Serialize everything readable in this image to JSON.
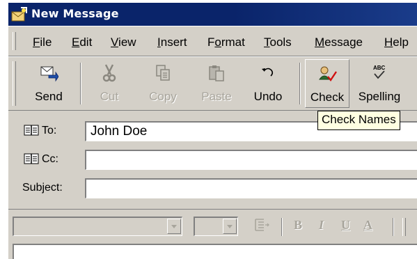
{
  "window": {
    "title": "New Message"
  },
  "menu": [
    {
      "pre": "",
      "u": "F",
      "post": "ile"
    },
    {
      "pre": "",
      "u": "E",
      "post": "dit"
    },
    {
      "pre": "",
      "u": "V",
      "post": "iew"
    },
    {
      "pre": "",
      "u": "I",
      "post": "nsert"
    },
    {
      "pre": "F",
      "u": "o",
      "post": "rmat"
    },
    {
      "pre": "",
      "u": "T",
      "post": "ools"
    },
    {
      "pre": "",
      "u": "M",
      "post": "essage"
    },
    {
      "pre": "",
      "u": "H",
      "post": "elp"
    }
  ],
  "toolbar": {
    "send": {
      "label": "Send",
      "icon": "send-icon",
      "enabled": true
    },
    "cut": {
      "label": "Cut",
      "icon": "scissors-icon",
      "enabled": false
    },
    "copy": {
      "label": "Copy",
      "icon": "copy-icon",
      "enabled": false
    },
    "paste": {
      "label": "Paste",
      "icon": "paste-icon",
      "enabled": false
    },
    "undo": {
      "label": "Undo",
      "icon": "undo-icon",
      "enabled": true
    },
    "check": {
      "label": "Check",
      "icon": "check-names-icon",
      "enabled": true,
      "pressed": true
    },
    "spelling": {
      "label": "Spelling",
      "icon": "spelling-icon",
      "enabled": true
    }
  },
  "tooltip": "Check Names",
  "fields": {
    "to": {
      "label": "To:",
      "value": "John Doe",
      "icon": "address-book-icon"
    },
    "cc": {
      "label": "Cc:",
      "value": "",
      "icon": "address-book-icon"
    },
    "subject": {
      "label": "Subject:",
      "value": ""
    }
  },
  "format": {
    "font_value": "",
    "size_value": "",
    "bold": "B",
    "italic": "I",
    "underline": "U",
    "font_color": "A",
    "enabled": false
  },
  "colors": {
    "titlebar": "#0a246a",
    "face": "#d4d0c8",
    "tooltip_bg": "#ffffe1",
    "disabled_text": "#a8a59c"
  }
}
